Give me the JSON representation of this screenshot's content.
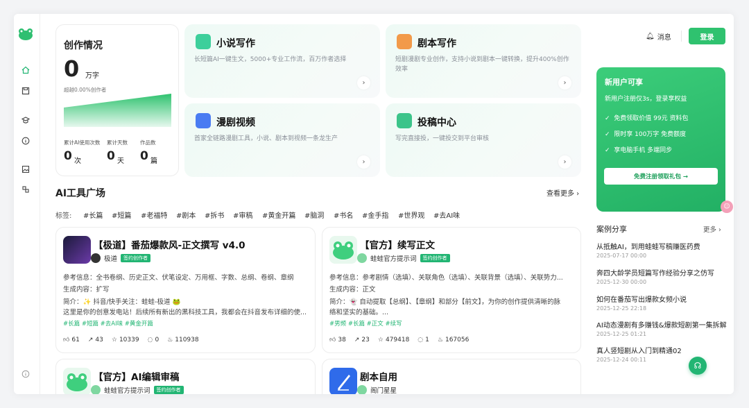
{
  "sidebar": {
    "logo": "frog-logo"
  },
  "stats_card": {
    "title": "创作情况",
    "words": "0",
    "words_unit": "万字",
    "beat_text": "超越0.00%创作者",
    "labels": [
      "累计AI使用次数",
      "累计天数",
      "作品数"
    ],
    "values": [
      "0",
      "0",
      "0"
    ],
    "units": [
      "次",
      "天",
      "篇"
    ]
  },
  "features": [
    {
      "title": "小说写作",
      "desc": "长短篇AI一键生文，5000+专业工作流，百万作者选择",
      "icon": "book-icon",
      "color": "#3dcf9b"
    },
    {
      "title": "剧本写作",
      "desc": "短剧漫剧专业创作，支持小说到剧本一键转换，提升400%创作效率",
      "icon": "script-icon",
      "color": "#f29a4a"
    },
    {
      "title": "漫剧视频",
      "desc": "首家全链路漫剧工具，小说、剧本到视频一条龙生产",
      "icon": "video-icon",
      "color": "#4a7cf2"
    },
    {
      "title": "投稿中心",
      "desc": "写完直接投，一键投交到平台审核",
      "icon": "submit-icon",
      "color": "#3cc48a"
    }
  ],
  "header": {
    "message": "消息",
    "login": "登录"
  },
  "promo": {
    "title": "新用户可享",
    "subtitle": "新用户注册仅3s，登录享权益",
    "items": [
      "免费领取价值 99元 资料包",
      "限时享 100万字 免费额度",
      "享电脑手机 多端同步"
    ],
    "button": "免费注册领取礼包 →"
  },
  "tools_section": {
    "title": "AI工具广场",
    "more": "查看更多 ›",
    "tags_label": "标签:",
    "tags": [
      "#长篇",
      "#短篇",
      "#老福特",
      "#剧本",
      "#拆书",
      "#审稿",
      "#黄金开篇",
      "#脑洞",
      "#书名",
      "#金手指",
      "#世界观",
      "#去AI味"
    ]
  },
  "tools": [
    {
      "name": "【极道】番茄爆款风-正文撰写 v4.0",
      "author": "极道",
      "badge": "签约创作者",
      "ref": "参考信息：全书卷纲、历史正文、伏笔设定、万用框、字数、总纲、卷纲、章纲",
      "gen": "生成内容：扩写",
      "intro1": "简介：✨ 抖音/快手关注：蛙蛙-极道 🐸",
      "intro2": "这里是你的创意发电站！后续所有新出的黑科技工具，我都会在抖音发布详细的使...",
      "tags": "#长篇  #短篇  #去AI味  #黄金开篇",
      "likes": "61",
      "shares": "43",
      "stars": "10339",
      "comments": "0",
      "uses": "110938"
    },
    {
      "name": "【官方】续写正文",
      "author": "蛙蛙官方提示词",
      "badge": "签约创作者",
      "ref": "参考信息：参考剧情（选填）、关联角色（选填）、关联背景（选填）、关联势力...",
      "gen": "生成内容：正文",
      "intro1": "简介：👻 自动提取【总纲】、【章纲】和部分【前文】，为你的创作提供清晰的脉",
      "intro2": "络和坚实的基础。...",
      "tags": "#男频  #长篇  #正文  #续写",
      "likes": "38",
      "shares": "23",
      "stars": "479418",
      "comments": "1",
      "uses": "167056"
    },
    {
      "name": "【官方】AI编辑审稿",
      "author": "蛙蛙官方提示词",
      "badge": "签约创作者"
    },
    {
      "name": "剧本自用",
      "author": "阁门星星"
    }
  ],
  "cases": {
    "title": "案例分享",
    "more": "更多 ›",
    "items": [
      {
        "title": "从抵触AI，到用蛙蛙写稿赚医药费",
        "date": "2025-07-17 00:00"
      },
      {
        "title": "奔四大龄学员短篇写作经验分享之仿写",
        "date": "2025-12-30 00:00"
      },
      {
        "title": "如何在番茄写出爆款女频小说",
        "date": "2025-12-25 22:18"
      },
      {
        "title": "AI动态漫剧有多赚钱&爆款短剧第一集拆解",
        "date": "2025-12-25 01:21"
      },
      {
        "title": "真人竖短剧从入门到精通02",
        "date": "2025-12-24 00:11"
      }
    ]
  },
  "colors": {
    "accent": "#22b573",
    "promo_bg": "#2fc26f"
  }
}
